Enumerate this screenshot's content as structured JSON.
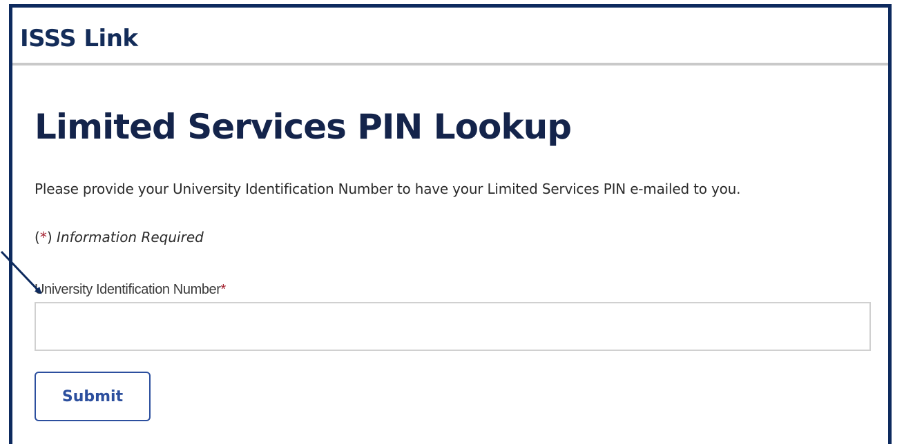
{
  "header": {
    "app_title": "ISSS Link"
  },
  "main": {
    "page_title": "Limited Services PIN Lookup",
    "instructions": "Please provide your University Identification Number to have your Limited Services PIN e-mailed to you.",
    "required_note": {
      "open_paren": "(",
      "star": "*",
      "close_paren": ")",
      "text": "Information Required"
    },
    "field": {
      "label": "University Identification Number",
      "required_star": "*",
      "value": "",
      "placeholder": ""
    },
    "submit_label": "Submit"
  },
  "colors": {
    "frame_border": "#0d2a5e",
    "title_text": "#14244b",
    "button_accent": "#2c4f9e",
    "required_star": "#a4202f",
    "header_rule": "#c9c9c9"
  },
  "annotation": {
    "icon": "arrow-icon"
  }
}
